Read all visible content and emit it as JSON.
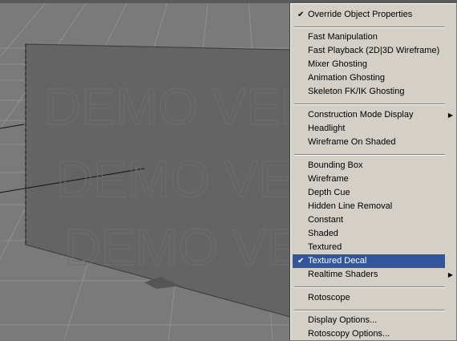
{
  "colors": {
    "viewport_bg": "#787878",
    "menu_bg": "#d4d0c8",
    "highlight": "#30559d",
    "plane": "#666666"
  },
  "viewport": {
    "watermark": [
      "DEMO VERSION",
      "DEMO VERSION",
      "DEMO VERSION"
    ]
  },
  "menu": {
    "override": {
      "label": "Override Object Properties",
      "checked": true
    },
    "group1": [
      {
        "label": "Fast Manipulation"
      },
      {
        "label": "Fast Playback (2D|3D Wireframe)"
      },
      {
        "label": "Mixer Ghosting"
      },
      {
        "label": "Animation Ghosting"
      },
      {
        "label": "Skeleton FK/IK Ghosting"
      }
    ],
    "group2": [
      {
        "label": "Construction Mode Display",
        "submenu": true
      },
      {
        "label": "Headlight"
      },
      {
        "label": "Wireframe On Shaded"
      }
    ],
    "group3": [
      {
        "label": "Bounding Box"
      },
      {
        "label": "Wireframe"
      },
      {
        "label": "Depth Cue"
      },
      {
        "label": "Hidden Line Removal"
      },
      {
        "label": "Constant"
      },
      {
        "label": "Shaded"
      },
      {
        "label": "Textured"
      },
      {
        "label": "Textured Decal",
        "checked": true,
        "highlighted": true
      },
      {
        "label": "Realtime Shaders",
        "submenu": true
      }
    ],
    "group4": [
      {
        "label": "Rotoscope"
      }
    ],
    "group5": [
      {
        "label": "Display Options..."
      },
      {
        "label": "Rotoscopy Options..."
      }
    ]
  }
}
